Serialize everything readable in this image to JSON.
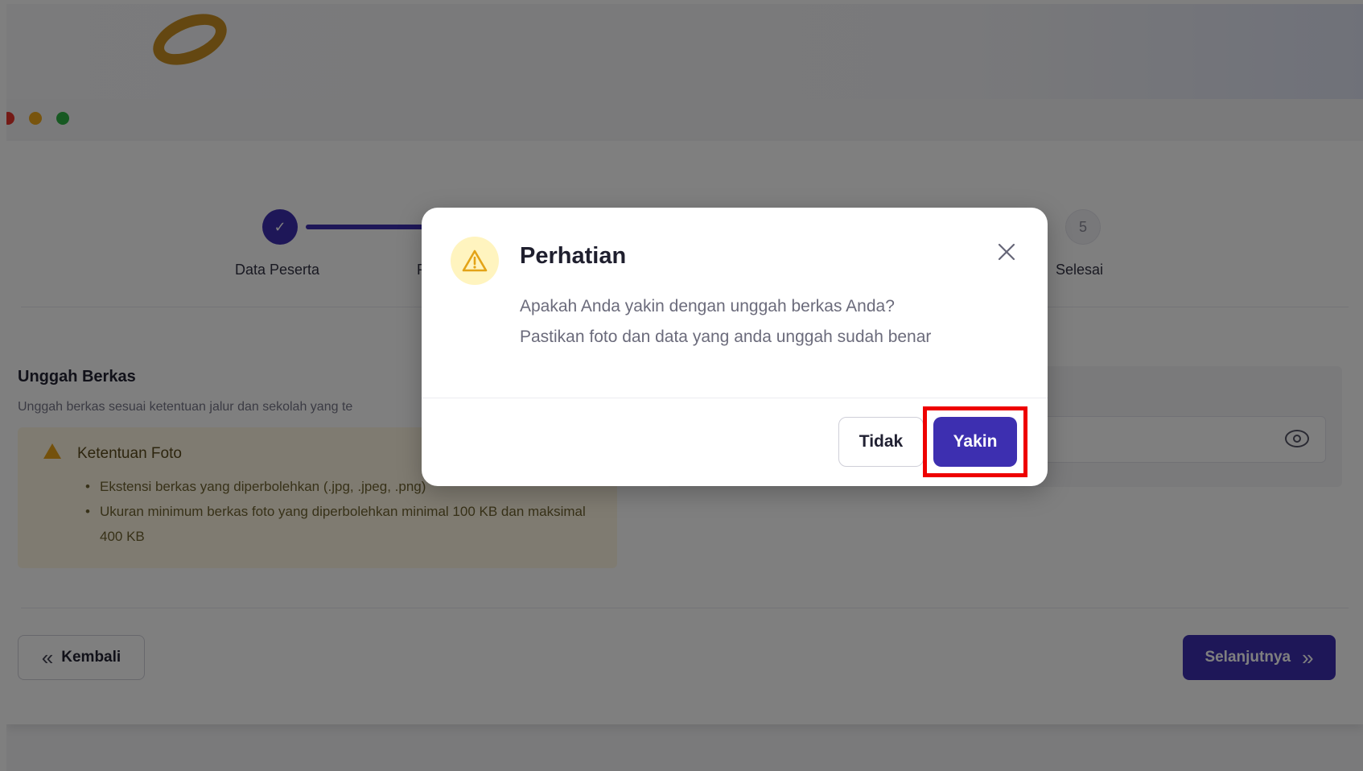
{
  "window_dots": [
    "#e8342c",
    "#f0a91c",
    "#2fb344"
  ],
  "stepper": {
    "step1_label": "Data Peserta",
    "step1_check": "✓",
    "step2_label_partial": "P",
    "step5_number": "5",
    "step5_label": "Selesai"
  },
  "upload": {
    "title": "Unggah Berkas",
    "subtitle": "Unggah berkas sesuai ketentuan jalur dan sekolah yang te"
  },
  "photo_rules": {
    "title": "Ketentuan Foto",
    "items": [
      "Ekstensi berkas yang diperbolehkan (.jpg, .jpeg, .png)",
      "Ukuran minimum berkas foto yang diperbolehkan minimal 100 KB dan maksimal 400 KB"
    ]
  },
  "nav": {
    "back_label": "Kembali",
    "back_icon": "chevrons-left-icon",
    "next_label": "Selanjutnya",
    "next_icon": "chevrons-right-icon"
  },
  "modal": {
    "title": "Perhatian",
    "line1": "Apakah Anda yakin dengan unggah berkas Anda?",
    "line2": "Pastikan foto dan data yang anda unggah sudah benar",
    "cancel_label": "Tidak",
    "confirm_label": "Yakin",
    "icon": "warning-icon",
    "close_icon": "close-icon"
  },
  "colors": {
    "primary": "#3d2fb0",
    "highlight": "#ee0000",
    "warning_bg": "#fff4bf"
  }
}
